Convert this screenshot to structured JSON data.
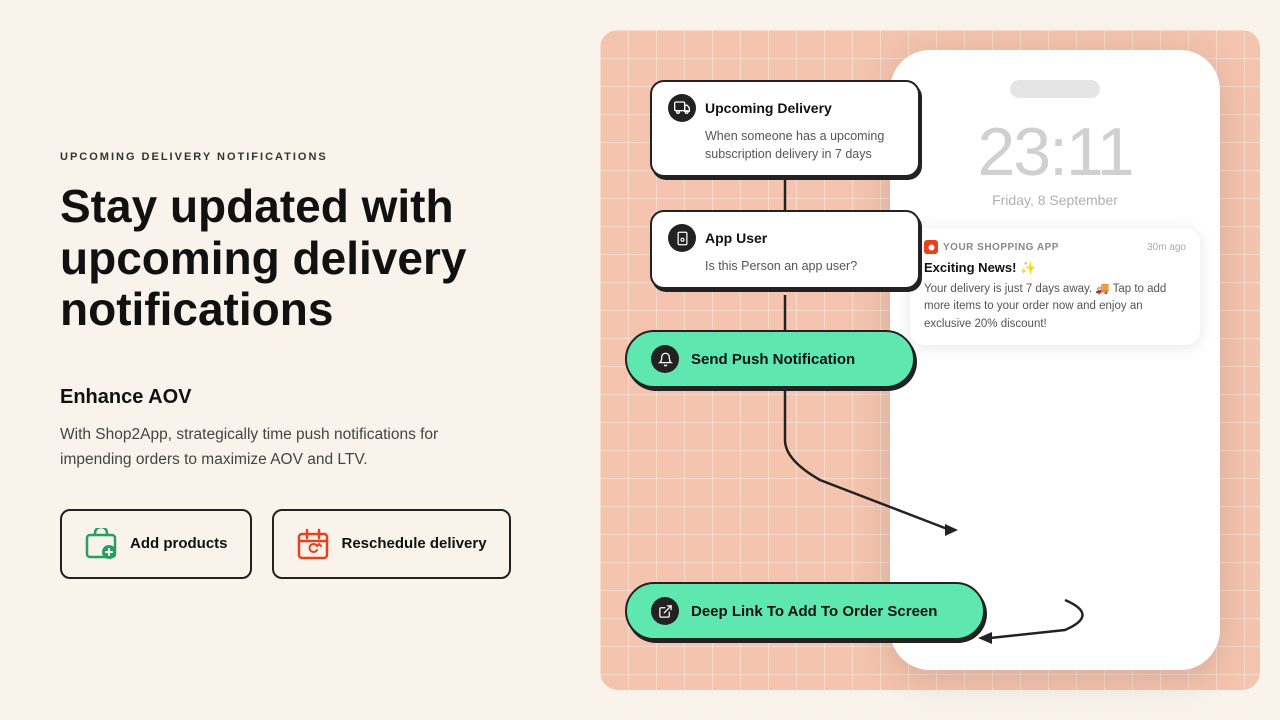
{
  "left": {
    "section_label": "UPCOMING DELIVERY NOTIFICATIONS",
    "heading": "Stay updated with upcoming delivery notifications",
    "enhance_title": "Enhance AOV",
    "enhance_desc": "With Shop2App, strategically time push notifications for impending orders to maximize AOV and LTV.",
    "buttons": [
      {
        "id": "add-products",
        "label": "Add products"
      },
      {
        "id": "reschedule",
        "label": "Reschedule delivery"
      }
    ]
  },
  "right": {
    "flow": {
      "node_delivery": {
        "title": "Upcoming Delivery",
        "desc": "When someone has a upcoming subscription delivery in 7 days"
      },
      "node_appuser": {
        "title": "App User",
        "desc": "Is this Person an app user?"
      },
      "node_push": {
        "label": "Send Push Notification"
      },
      "node_deeplink": {
        "label": "Deep Link To Add To Order Screen"
      }
    },
    "phone": {
      "time": "23:11",
      "date": "Friday, 8 September",
      "notification": {
        "app_name": "YOUR SHOPPING APP",
        "time_ago": "30m ago",
        "title": "Exciting News! ✨",
        "body": "Your delivery is just 7 days away. 🚚 Tap to add more items to your order now and enjoy an exclusive 20% discount!"
      }
    }
  }
}
